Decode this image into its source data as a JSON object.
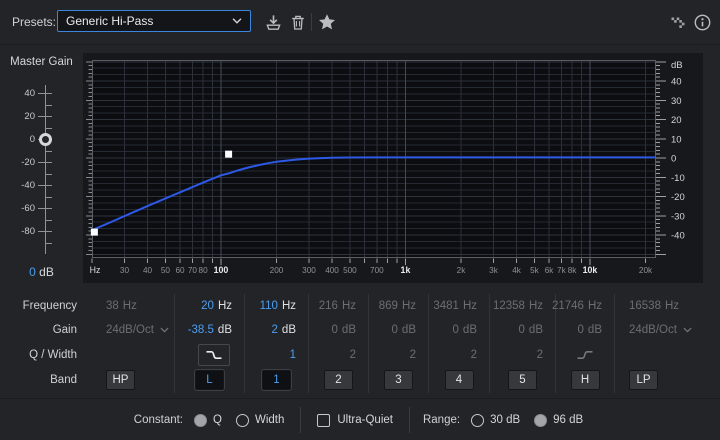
{
  "toolbar": {
    "presets_label": "Presets:",
    "preset_value": "Generic Hi-Pass",
    "icons": [
      "chevron-down-icon",
      "save-icon",
      "trash-icon",
      "star-icon",
      "routing-icon",
      "info-icon"
    ]
  },
  "master_gain": {
    "label": "Master Gain",
    "tick_labels": [
      "40",
      "20",
      "0",
      "-20",
      "-40",
      "-60",
      "-80"
    ],
    "knob_db": 0,
    "value_num": "0",
    "value_unit": "dB"
  },
  "chart_data": {
    "type": "line",
    "title": "Parametric EQ frequency response",
    "x_axis": {
      "label": "Hz",
      "scale": "log",
      "min": 20,
      "max": 23000,
      "ticks": [
        {
          "f": 20,
          "label": "Hz",
          "major": false
        },
        {
          "f": 30,
          "label": "30",
          "major": false
        },
        {
          "f": 40,
          "label": "40",
          "major": false
        },
        {
          "f": 50,
          "label": "50",
          "major": false
        },
        {
          "f": 60,
          "label": "60",
          "major": false
        },
        {
          "f": 70,
          "label": "70",
          "major": false
        },
        {
          "f": 80,
          "label": "80",
          "major": false
        },
        {
          "f": 90,
          "label": "",
          "major": false
        },
        {
          "f": 100,
          "label": "100",
          "major": true
        },
        {
          "f": 200,
          "label": "200",
          "major": false
        },
        {
          "f": 300,
          "label": "300",
          "major": false
        },
        {
          "f": 400,
          "label": "400",
          "major": false
        },
        {
          "f": 500,
          "label": "500",
          "major": false
        },
        {
          "f": 600,
          "label": "",
          "major": false
        },
        {
          "f": 700,
          "label": "700",
          "major": false
        },
        {
          "f": 800,
          "label": "",
          "major": false
        },
        {
          "f": 900,
          "label": "",
          "major": false
        },
        {
          "f": 1000,
          "label": "1k",
          "major": true
        },
        {
          "f": 2000,
          "label": "2k",
          "major": false
        },
        {
          "f": 3000,
          "label": "3k",
          "major": false
        },
        {
          "f": 4000,
          "label": "4k",
          "major": false
        },
        {
          "f": 5000,
          "label": "5k",
          "major": false
        },
        {
          "f": 6000,
          "label": "6k",
          "major": false
        },
        {
          "f": 7000,
          "label": "7k",
          "major": false
        },
        {
          "f": 8000,
          "label": "8k",
          "major": false
        },
        {
          "f": 9000,
          "label": "",
          "major": false
        },
        {
          "f": 10000,
          "label": "10k",
          "major": true
        },
        {
          "f": 20000,
          "label": "20k",
          "major": false
        }
      ]
    },
    "y_axis": {
      "label": "dB",
      "min": -52,
      "max": 51,
      "tick_values": [
        40,
        30,
        20,
        10,
        0,
        -10,
        -20,
        -30,
        -40
      ]
    },
    "series": [
      {
        "name": "eq-response",
        "color": "#2e59e6",
        "points": [
          [
            20,
            -37.5
          ],
          [
            25,
            -33.5
          ],
          [
            32,
            -29
          ],
          [
            40,
            -25
          ],
          [
            50,
            -21
          ],
          [
            63,
            -17
          ],
          [
            80,
            -12.8
          ],
          [
            100,
            -9
          ],
          [
            110,
            -8
          ],
          [
            125,
            -6.3
          ],
          [
            140,
            -5
          ],
          [
            160,
            -3.7
          ],
          [
            180,
            -2.7
          ],
          [
            200,
            -2
          ],
          [
            230,
            -1.3
          ],
          [
            260,
            -0.8
          ],
          [
            300,
            -0.3
          ],
          [
            350,
            -0.05
          ],
          [
            400,
            0.1
          ],
          [
            500,
            0.25
          ],
          [
            700,
            0.3
          ],
          [
            1000,
            0.3
          ],
          [
            2000,
            0.3
          ],
          [
            23500,
            0.3
          ]
        ]
      }
    ],
    "markers": [
      {
        "label": "L",
        "freq": 20.6,
        "gain": -38.5
      },
      {
        "label": "1",
        "freq": 110,
        "gain": 2
      }
    ]
  },
  "eq": {
    "row_labels": [
      "Frequency",
      "Gain",
      "Q / Width",
      "Band"
    ],
    "columns": [
      {
        "id": "hp",
        "band": "HP",
        "enabled": false,
        "align": "left",
        "freq_num": "38",
        "freq_unit": "Hz",
        "gain_dropdown": "24dB/Oct",
        "q": ""
      },
      {
        "id": "l",
        "band": "L",
        "enabled": true,
        "freq_num": "20",
        "freq_unit": "Hz",
        "gain_num": "-38.5",
        "gain_unit": "dB",
        "q_icon": "shelf-low"
      },
      {
        "id": "1",
        "band": "1",
        "enabled": true,
        "freq_num": "110",
        "freq_unit": "Hz",
        "gain_num": "2",
        "gain_unit": "dB",
        "q": "1"
      },
      {
        "id": "2",
        "band": "2",
        "enabled": false,
        "freq_num": "216",
        "freq_unit": "Hz",
        "gain_num": "0",
        "gain_unit": "dB",
        "q": "2"
      },
      {
        "id": "3",
        "band": "3",
        "enabled": false,
        "freq_num": "869",
        "freq_unit": "Hz",
        "gain_num": "0",
        "gain_unit": "dB",
        "q": "2"
      },
      {
        "id": "4",
        "band": "4",
        "enabled": false,
        "freq_num": "3481",
        "freq_unit": "Hz",
        "gain_num": "0",
        "gain_unit": "dB",
        "q": "2"
      },
      {
        "id": "5",
        "band": "5",
        "enabled": false,
        "freq_num": "12358",
        "freq_unit": "Hz",
        "gain_num": "0",
        "gain_unit": "dB",
        "q": "2"
      },
      {
        "id": "h",
        "band": "H",
        "enabled": false,
        "freq_num": "21746",
        "freq_unit": "Hz",
        "gain_num": "0",
        "gain_unit": "dB",
        "q_icon": "shelf-high"
      },
      {
        "id": "lp",
        "band": "LP",
        "enabled": false,
        "align": "left2",
        "freq_num": "16538",
        "freq_unit": "Hz",
        "gain_dropdown": "24dB/Oct",
        "q": ""
      }
    ]
  },
  "footer": {
    "constant_label": "Constant:",
    "constant_options": [
      {
        "label": "Q",
        "selected": true
      },
      {
        "label": "Width",
        "selected": false
      }
    ],
    "ultra_quiet_label": "Ultra-Quiet",
    "ultra_quiet_checked": false,
    "range_label": "Range:",
    "range_options": [
      {
        "label": "30 dB",
        "selected": false
      },
      {
        "label": "96 dB",
        "selected": true
      }
    ]
  },
  "colors": {
    "accent_blue": "#4b9ef0",
    "curve_blue": "#2e59e6",
    "dropdown_border": "#3c87dd",
    "plot_bg": "#0b0d11",
    "panel_bg": "#17181c",
    "window_bg": "#232428"
  }
}
